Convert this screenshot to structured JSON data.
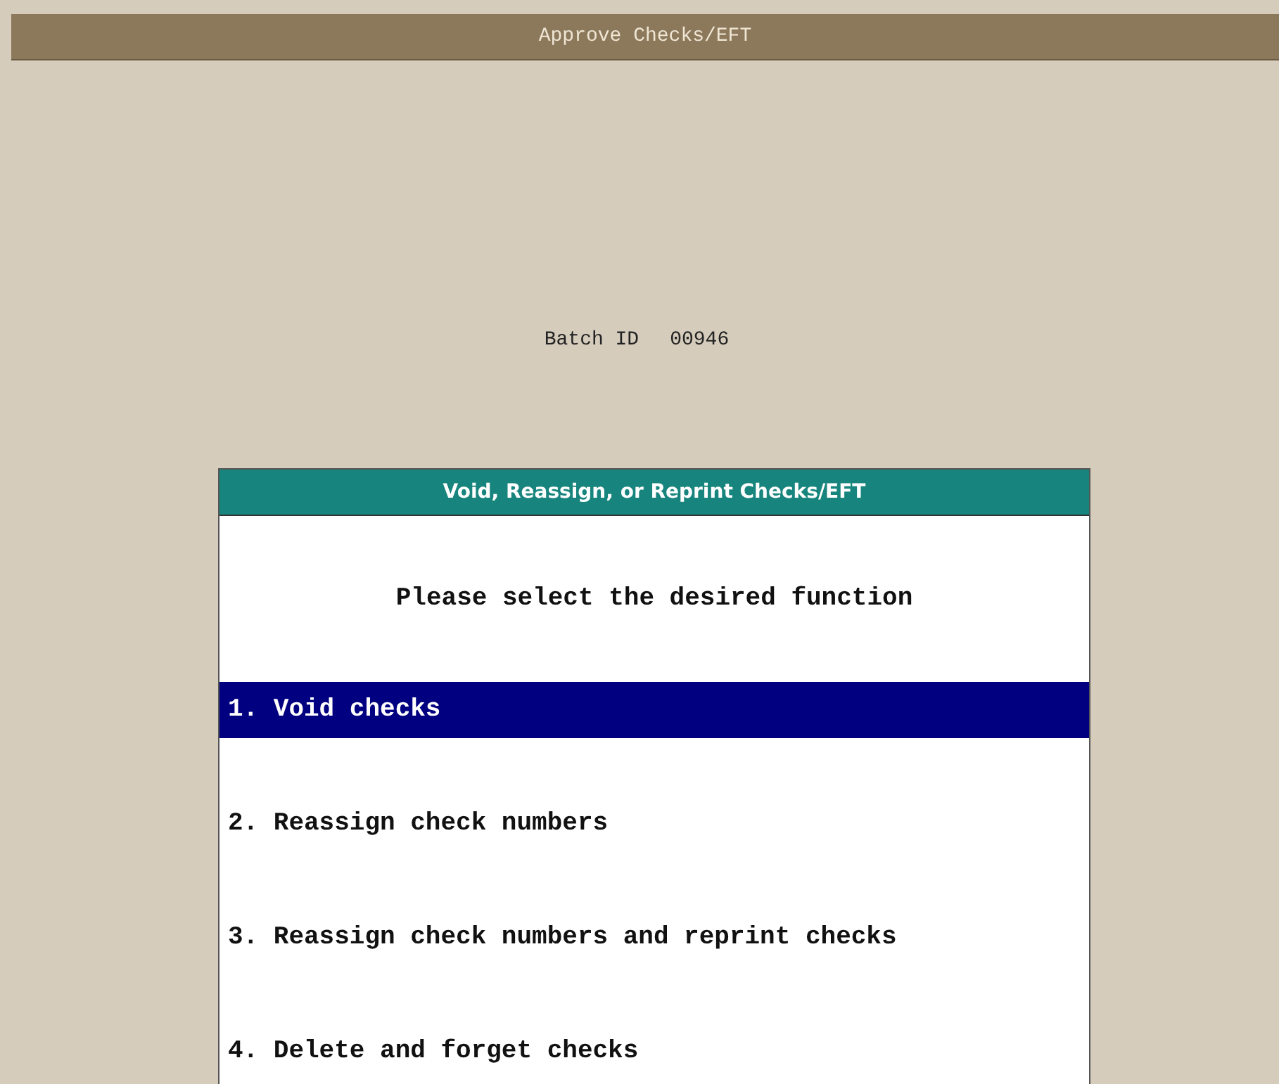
{
  "window": {
    "title": "Approve Checks/EFT"
  },
  "batch": {
    "label": "Batch ID",
    "value": "00946"
  },
  "dialog": {
    "title": "Void, Reassign, or Reprint Checks/EFT",
    "prompt": "Please select the desired function",
    "options": [
      {
        "label": "1. Void checks",
        "selected": true
      },
      {
        "label": "2. Reassign check numbers",
        "selected": false
      },
      {
        "label": "3. Reassign check numbers and reprint checks",
        "selected": false
      },
      {
        "label": "4. Delete and forget checks",
        "selected": false
      }
    ]
  }
}
